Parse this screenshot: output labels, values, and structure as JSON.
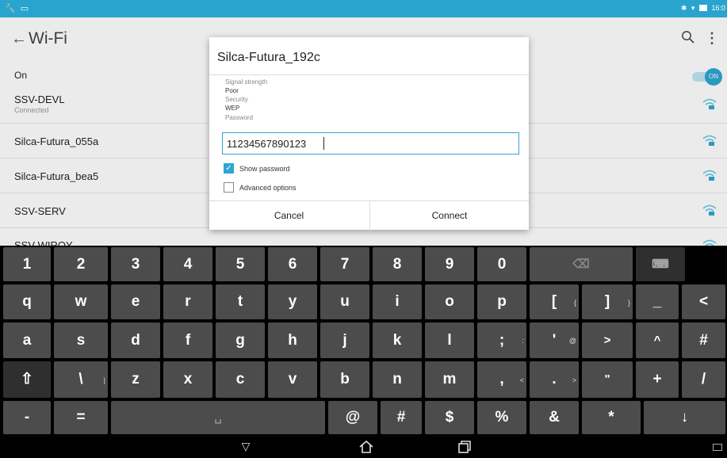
{
  "status_bar": {
    "left_icons": [
      "wrench-icon",
      "screen-icon"
    ],
    "right_icons": [
      "bluetooth-icon",
      "wifi-icon",
      "battery-icon"
    ],
    "time": "16:0"
  },
  "header": {
    "back_glyph": "←",
    "title": "Wi-Fi",
    "overflow_glyph": "⋮"
  },
  "wifi": {
    "on_label": "On",
    "toggle_label": "ON",
    "networks": [
      {
        "name": "SSV-DEVL",
        "status": "Connected"
      },
      {
        "name": "Silca-Futura_055a",
        "status": ""
      },
      {
        "name": "Silca-Futura_bea5",
        "status": ""
      },
      {
        "name": "SSV-SERV",
        "status": ""
      },
      {
        "name": "SSV-WIROY",
        "status": ""
      }
    ]
  },
  "dialog": {
    "title": "Silca-Futura_192c",
    "signal_label": "Signal strength",
    "signal_value": "Poor",
    "security_label": "Security",
    "security_value": "WEP",
    "password_label": "Password",
    "password_value": "11234567890123",
    "show_password_label": "Show password",
    "show_password_checked": true,
    "advanced_label": "Advanced options",
    "advanced_checked": false,
    "cancel_label": "Cancel",
    "connect_label": "Connect",
    "accent_color": "#2ea6d3"
  },
  "keyboard": {
    "row1": [
      {
        "main": "1",
        "alt": ""
      },
      {
        "main": "2",
        "alt": ""
      },
      {
        "main": "3",
        "alt": ""
      },
      {
        "main": "4",
        "alt": ""
      },
      {
        "main": "5",
        "alt": ""
      },
      {
        "main": "6",
        "alt": ""
      },
      {
        "main": "7",
        "alt": ""
      },
      {
        "main": "8",
        "alt": ""
      },
      {
        "main": "9",
        "alt": ""
      },
      {
        "main": "0",
        "alt": ""
      },
      {
        "main": "⌫",
        "alt": ""
      },
      {
        "main": "⌨",
        "alt": ""
      }
    ],
    "row2": [
      {
        "main": "q",
        "alt": ""
      },
      {
        "main": "w",
        "alt": ""
      },
      {
        "main": "e",
        "alt": ""
      },
      {
        "main": "r",
        "alt": ""
      },
      {
        "main": "t",
        "alt": ""
      },
      {
        "main": "y",
        "alt": ""
      },
      {
        "main": "u",
        "alt": ""
      },
      {
        "main": "i",
        "alt": ""
      },
      {
        "main": "o",
        "alt": ""
      },
      {
        "main": "p",
        "alt": ""
      },
      {
        "main": "[",
        "alt": "{"
      },
      {
        "main": "]",
        "alt": "}"
      },
      {
        "main": "_",
        "alt": ""
      },
      {
        "main": "<",
        "alt": ""
      }
    ],
    "row3": [
      {
        "main": "a",
        "alt": ""
      },
      {
        "main": "s",
        "alt": ""
      },
      {
        "main": "d",
        "alt": ""
      },
      {
        "main": "f",
        "alt": ""
      },
      {
        "main": "g",
        "alt": ""
      },
      {
        "main": "h",
        "alt": ""
      },
      {
        "main": "j",
        "alt": ""
      },
      {
        "main": "k",
        "alt": ""
      },
      {
        "main": "l",
        "alt": ""
      },
      {
        "main": ";",
        "alt": ":"
      },
      {
        "main": "'",
        "alt": "@"
      },
      {
        "main": ">",
        "alt": ""
      },
      {
        "main": "^",
        "alt": ""
      },
      {
        "main": "#",
        "alt": ""
      }
    ],
    "row4": [
      {
        "main": "⇧",
        "alt": ""
      },
      {
        "main": "\\",
        "alt": "|"
      },
      {
        "main": "z",
        "alt": ""
      },
      {
        "main": "x",
        "alt": ""
      },
      {
        "main": "c",
        "alt": ""
      },
      {
        "main": "v",
        "alt": ""
      },
      {
        "main": "b",
        "alt": ""
      },
      {
        "main": "n",
        "alt": ""
      },
      {
        "main": "m",
        "alt": ""
      },
      {
        "main": ",",
        "alt": "<"
      },
      {
        "main": ".",
        "alt": ">"
      },
      {
        "main": "\"",
        "alt": ""
      },
      {
        "main": "+",
        "alt": ""
      },
      {
        "main": "/",
        "alt": ""
      }
    ],
    "row5": [
      {
        "main": "-",
        "alt": ""
      },
      {
        "main": "=",
        "alt": ""
      },
      {
        "main": "␣",
        "alt": ""
      },
      {
        "main": "@",
        "alt": ""
      },
      {
        "main": "#",
        "alt": ""
      },
      {
        "main": "$",
        "alt": ""
      },
      {
        "main": "%",
        "alt": ""
      },
      {
        "main": "&",
        "alt": ""
      },
      {
        "main": "*",
        "alt": ""
      },
      {
        "main": "↓",
        "alt": ""
      }
    ]
  },
  "navbar": {
    "back_glyph": "▽",
    "home_icon": "home-icon",
    "recents_icon": "recents-icon"
  }
}
